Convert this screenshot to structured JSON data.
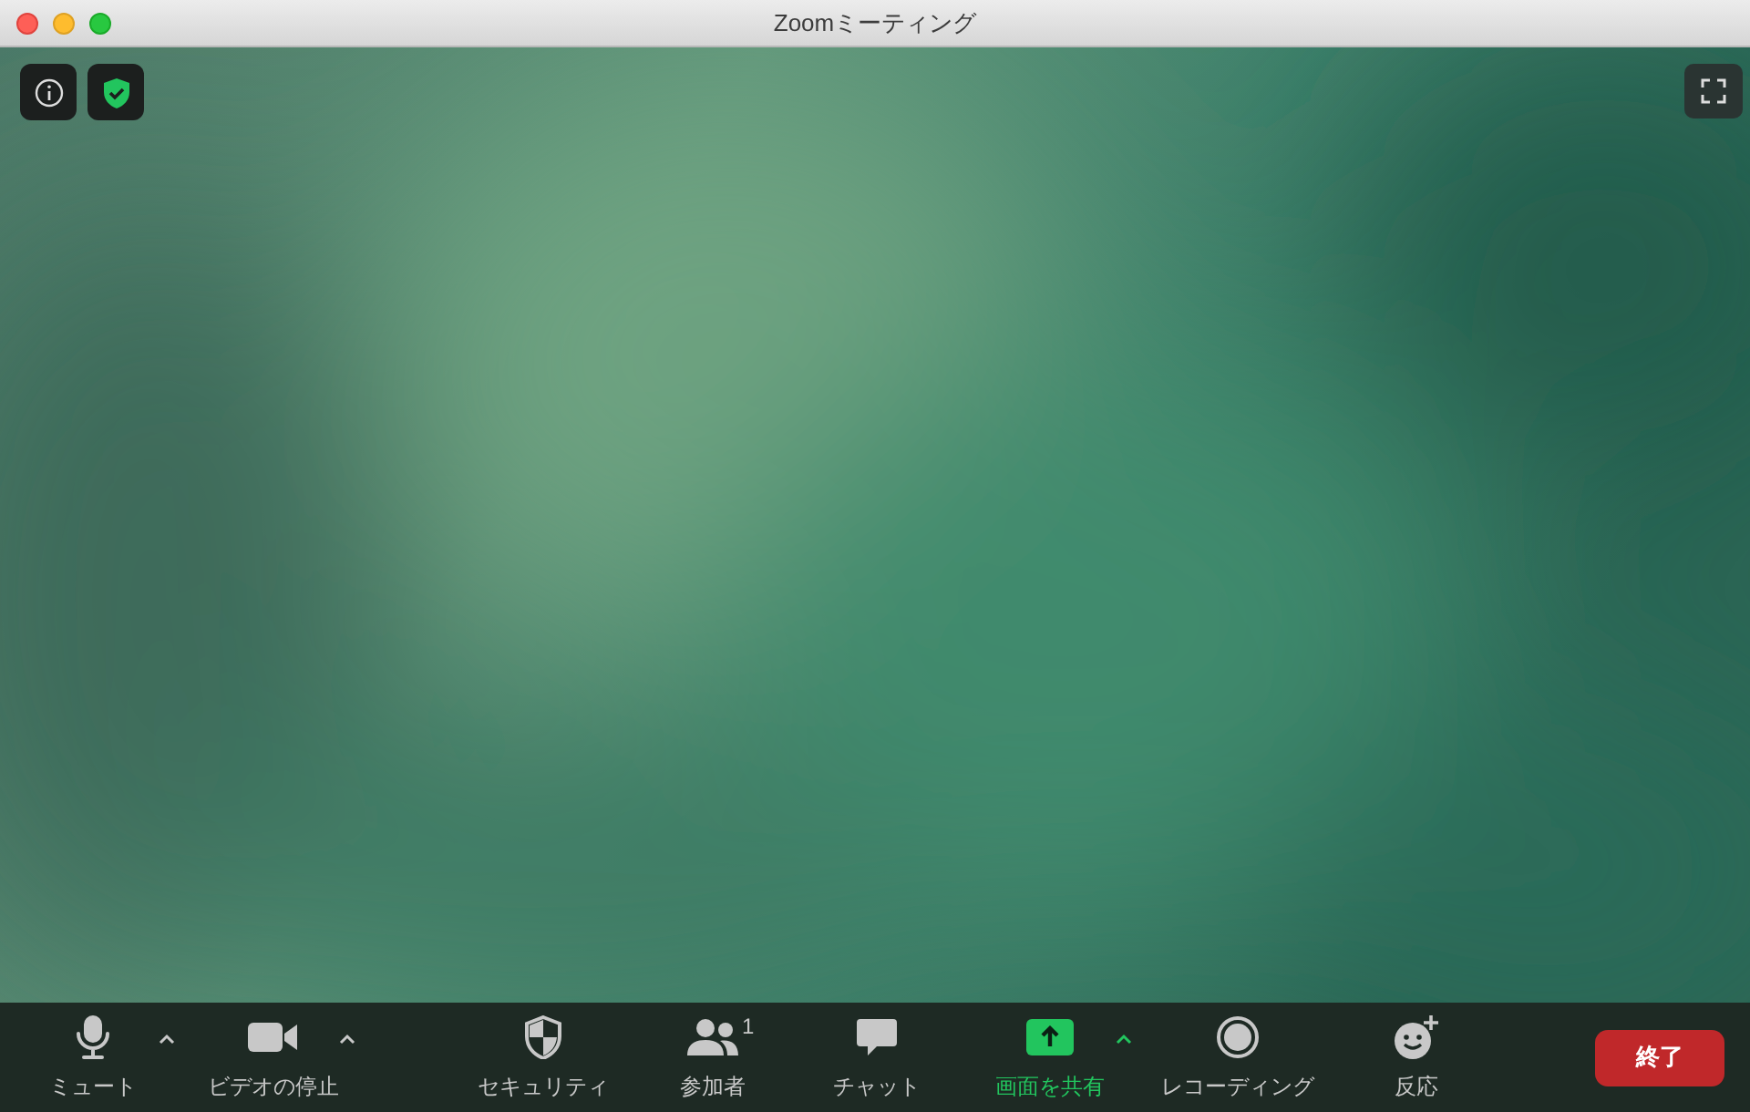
{
  "window": {
    "title": "Zoomミーティング"
  },
  "toolbar": {
    "items": [
      {
        "kind": "mic",
        "label": "ミュート",
        "menu": true,
        "highlighted": false
      },
      {
        "kind": "video",
        "label": "ビデオの停止",
        "menu": true,
        "highlighted": false
      },
      {
        "kind": "security",
        "label": "セキュリティ",
        "menu": false,
        "highlighted": false
      },
      {
        "kind": "participants",
        "label": "参加者",
        "count": "1",
        "menu": false,
        "highlighted": false
      },
      {
        "kind": "chat",
        "label": "チャット",
        "menu": false,
        "highlighted": false
      },
      {
        "kind": "share",
        "label": "画面を共有",
        "menu": true,
        "highlighted": true
      },
      {
        "kind": "record",
        "label": "レコーディング",
        "menu": false,
        "highlighted": false
      },
      {
        "kind": "reactions",
        "label": "反応",
        "menu": false,
        "highlighted": false
      }
    ],
    "end_button": "終了"
  }
}
